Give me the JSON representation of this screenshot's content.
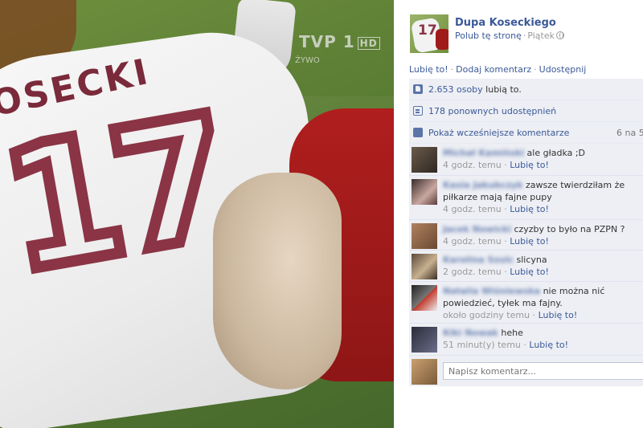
{
  "photo": {
    "jersey_name": "OSECKI",
    "jersey_number": "17",
    "tv_channel": "TVP 1",
    "tv_hd": "HD",
    "tv_live": "ŻYWO"
  },
  "header": {
    "page_name": "Dupa Koseckiego",
    "like_page": "Polub tę stronę",
    "time": "Piątek",
    "separator": "·"
  },
  "actions": {
    "like": "Lubię to!",
    "comment": "Dodaj komentarz",
    "share": "Udostępnij",
    "separator": "·"
  },
  "feedback": {
    "likes_count": "2.653 osoby",
    "likes_suffix": "lubią to.",
    "shares": "178 ponownych udostępnień",
    "show_earlier": "Pokaż wcześniejsze komentarze",
    "comment_count": "6 na 5"
  },
  "comments": [
    {
      "author": "Michał Kamiński",
      "text": "ale gładka ;D",
      "time": "4 godz. temu",
      "like": "Lubię to!"
    },
    {
      "author": "Kasia Jakubczyk",
      "text": "zawsze twierdziłam że piłkarze mają fajne pupy",
      "time": "4 godz. temu",
      "like": "Lubię to!"
    },
    {
      "author": "Jacek Nowicki",
      "text": "czyzby to było na PZPN ?",
      "time": "4 godz. temu",
      "like": "Lubię to!"
    },
    {
      "author": "Karolina Szulc",
      "text": "slicyna",
      "time": "2 godz. temu",
      "like": "Lubię to!"
    },
    {
      "author": "Natalia Wiśniewska",
      "text": "nie można nić powiedzieć, tyłek ma fajny.",
      "time": "około godziny temu",
      "like": "Lubię to!"
    },
    {
      "author": "Kiki Nowak",
      "text": "hehe",
      "time": "51 minut(y) temu",
      "like": "Lubię to!"
    }
  ],
  "composer": {
    "placeholder": "Napisz komentarz..."
  },
  "colors": {
    "link": "#3b5998",
    "feedback_bg": "#edeff4",
    "muted": "#999999"
  }
}
